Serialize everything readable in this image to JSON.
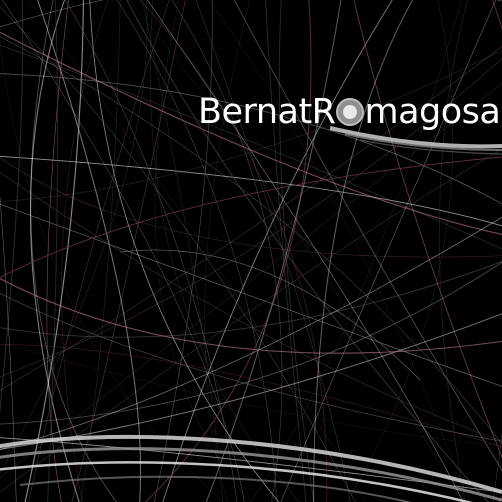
{
  "brand": {
    "first_part": "BernatR",
    "o_letter": "o",
    "last_part": "magosa"
  },
  "colors": {
    "background": "#000000",
    "line_white": "#ffffff",
    "line_grey": "#b0b0b0",
    "line_pink": "#c07a95",
    "line_dark_pink": "#6e3a4c"
  },
  "decor": {
    "small_label_1": "",
    "small_label_2": ""
  }
}
